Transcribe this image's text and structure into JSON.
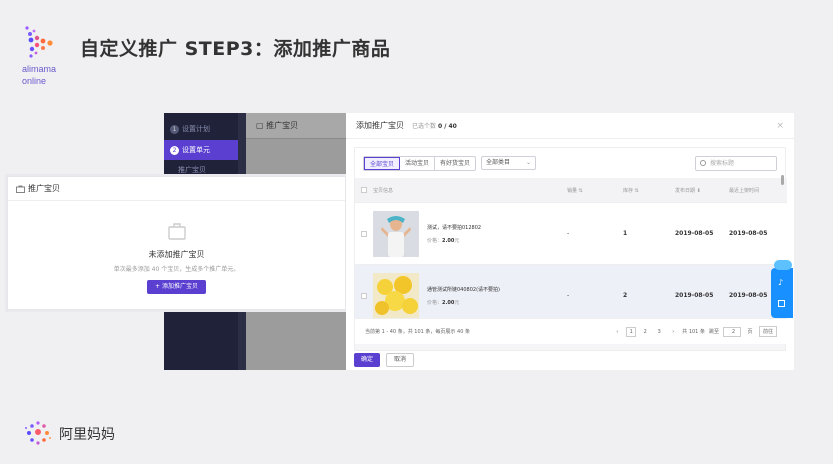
{
  "slide": {
    "logo_line1": "alimama",
    "logo_line2": "online",
    "title": "自定义推广 STEP3：添加推广商品",
    "footer_brand": "阿里妈妈"
  },
  "admin": {
    "nav": [
      {
        "num": "1",
        "label": "设置计划"
      },
      {
        "num": "2",
        "label": "设置单元"
      },
      {
        "num": "",
        "label": "推广宝贝"
      }
    ],
    "panel_title": "推广宝贝"
  },
  "empty_card": {
    "header": "推广宝贝",
    "title": "未添加推广宝贝",
    "desc": "单次最多添加 40 个宝贝，生成多个推广单元。",
    "button": "+ 添加推广宝贝"
  },
  "modal": {
    "title": "添加推广宝贝",
    "selected_label": "已选个数",
    "selected_value": "0 / 40",
    "close": "×",
    "tabs": [
      "全部宝贝",
      "活动宝贝",
      "有好货宝贝"
    ],
    "category": "全部类目",
    "search_placeholder": "搜索标题",
    "columns": [
      "宝贝信息",
      "销量 ⇅",
      "库存 ⇅",
      "发布日期 ⬇",
      "最近上架时间"
    ],
    "rows": [
      {
        "name": "测试，请不要拍012802",
        "price_label": "价格：",
        "price": "2.00",
        "unit": "元",
        "sales": "-",
        "stock": "1",
        "publish": "2019-08-05",
        "listed": "2019-08-05"
      },
      {
        "name": "通管测试所链040802(请不要拍)",
        "price_label": "价格：",
        "price": "2.00",
        "unit": "元",
        "sales": "-",
        "stock": "2",
        "publish": "2019-08-05",
        "listed": "2019-08-05"
      }
    ],
    "pager": {
      "summary": "当前第 1 - 40 条，共 101 条，每页展示 40 条",
      "prev": "‹",
      "pages": [
        "1",
        "2",
        "3"
      ],
      "next": "›",
      "total": "共 101 条",
      "goto_label": "跳至",
      "goto_value": "2",
      "page_unit": "页",
      "goto_button": "前往"
    },
    "ok": "确定",
    "cancel": "取消"
  }
}
